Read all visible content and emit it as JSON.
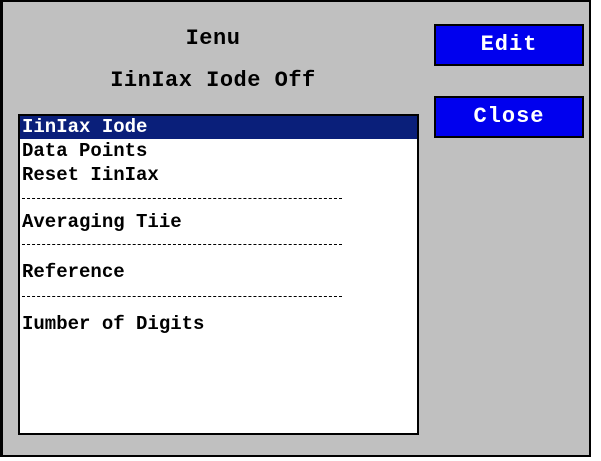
{
  "header": {
    "title": "Ienu",
    "mode_status": "IinIax Iode Off"
  },
  "menu": {
    "items": [
      {
        "label": "IinIax Iode",
        "selected": true
      },
      {
        "label": "Data Points",
        "selected": false
      },
      {
        "label": "Reset IinIax",
        "selected": false
      },
      {
        "label": "Averaging Tiie",
        "selected": false
      },
      {
        "label": "Reference",
        "selected": false
      },
      {
        "label": "Iumber of Digits",
        "selected": false
      }
    ]
  },
  "buttons": {
    "edit_label": "Edit",
    "close_label": "Close"
  },
  "colors": {
    "background": "#c0c0c0",
    "button": "#0000ee",
    "selection": "#0a1f7a",
    "list_background": "#ffffff"
  }
}
